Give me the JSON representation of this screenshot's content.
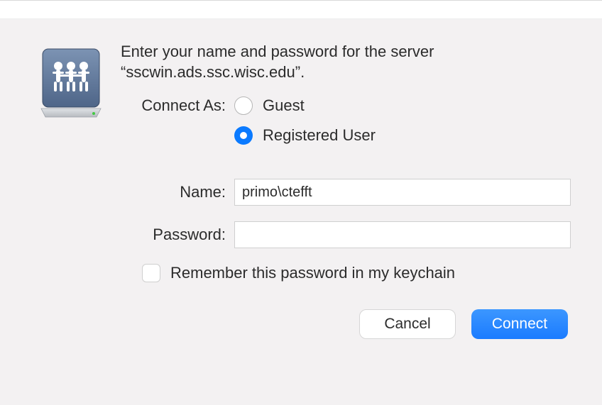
{
  "prompt_text": "Enter your name and password for the server “sscwin.ads.ssc.wisc.edu”.",
  "connect_as_label": "Connect As:",
  "radio": {
    "guest": "Guest",
    "registered": "Registered User",
    "selected": "registered"
  },
  "fields": {
    "name_label": "Name:",
    "name_value": "primo\\ctefft",
    "password_label": "Password:",
    "password_value": ""
  },
  "remember_label": "Remember this password in my keychain",
  "remember_checked": false,
  "buttons": {
    "cancel": "Cancel",
    "connect": "Connect"
  }
}
